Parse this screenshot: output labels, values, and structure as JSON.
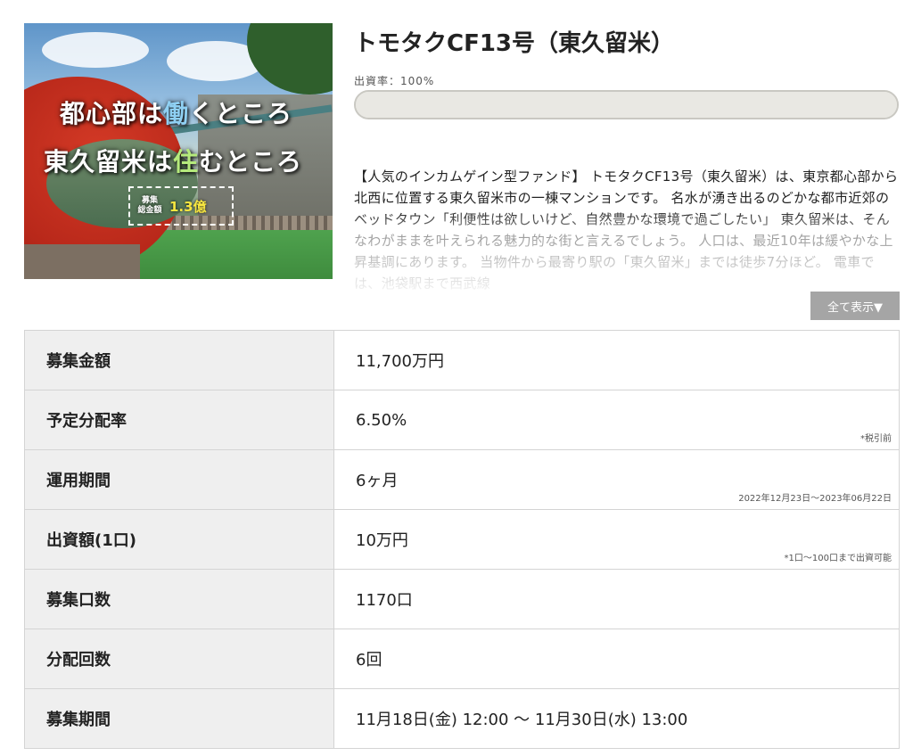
{
  "hero": {
    "line1_a": "都心部は",
    "line1_b": "働",
    "line1_c": "くところ",
    "line2_a": "東久留米は",
    "line2_b": "住",
    "line2_c": "むところ",
    "badge_label_1": "募集",
    "badge_label_2": "総金額",
    "badge_value": "1.3億"
  },
  "fund": {
    "title": "トモタクCF13号（東久留米）",
    "rate_label": "出資率：100%",
    "progress_fraction": 1.0,
    "description": "【人気のインカムゲイン型ファンド】 トモタクCF13号（東久留米）は、東京都心部から北西に位置する東久留米市の一棟マンションです。 名水が湧き出るのどかな都市近郊のベッドタウン「利便性は欲しいけど、自然豊かな環境で過ごしたい」 東久留米は、そんなわがままを叶えられる魅力的な街と言えるでしょう。 人口は、最近10年は緩やかな上昇基調にあります。 当物件から最寄り駅の「東久留米」までは徒歩7分ほど。 電車では、池袋駅まで西武線",
    "show_all": "全て表示▼"
  },
  "table": {
    "rows": [
      {
        "label": "募集金額",
        "value": "11,700万円",
        "note": ""
      },
      {
        "label": "予定分配率",
        "value": "6.50%",
        "note": "*税引前"
      },
      {
        "label": "運用期間",
        "value": "6ヶ月",
        "note": "2022年12月23日〜2023年06月22日"
      },
      {
        "label": "出資額(1口)",
        "value": "10万円",
        "note": "*1口〜100口まで出資可能"
      },
      {
        "label": "募集口数",
        "value": "1170口",
        "note": ""
      },
      {
        "label": "分配回数",
        "value": "6回",
        "note": ""
      },
      {
        "label": "募集期間",
        "value": "11月18日(金) 12:00 〜 11月30日(水) 13:00",
        "note": ""
      }
    ]
  },
  "colors": {
    "progress_bg": "#e9e8e3",
    "show_all_bg": "#a5a5a5",
    "table_header_bg": "#efefef"
  }
}
